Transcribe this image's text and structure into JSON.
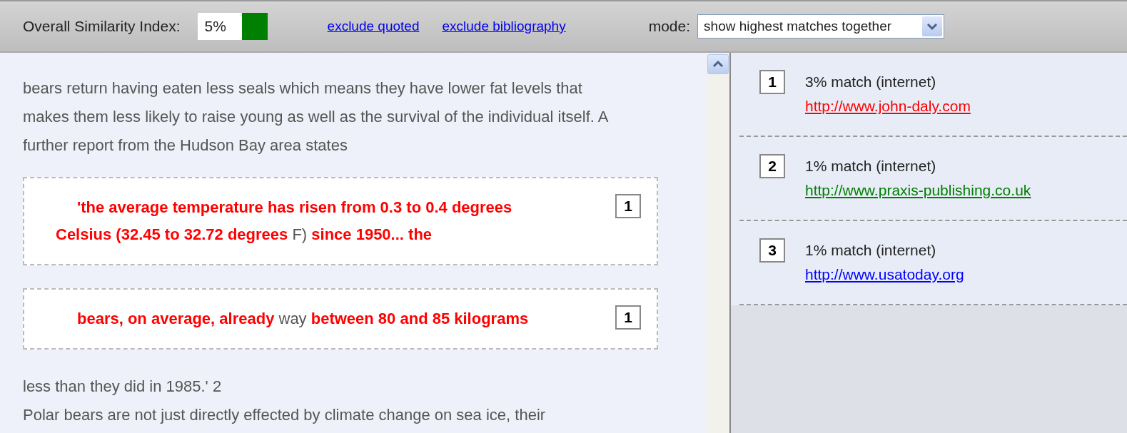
{
  "toolbar": {
    "similarity_label": "Overall Similarity Index:",
    "similarity_value": "5%",
    "links": [
      "exclude quoted",
      "exclude bibliography"
    ],
    "mode_label": "mode:",
    "mode_value": "show highest matches together"
  },
  "document": {
    "blocks": [
      {
        "kind": "paragraph",
        "text": "bears return having eaten less seals which means they have lower fat levels that makes them less likely to raise young as well as the survival of the individual itself. A further report from the Hudson Bay area states"
      },
      {
        "kind": "quote",
        "text": "**'the average temperature has risen from 0.3 to 0.4 degrees Celsius (32.45 to 32.72 degrees** F) **since 1950... the**",
        "source": "1"
      },
      {
        "kind": "quote",
        "text": "**bears, on average, already** way **between 80 and 85 kilograms**",
        "source": "1"
      },
      {
        "kind": "paragraph",
        "text": "less than they did in 1985.' 2"
      },
      {
        "kind": "paragraph",
        "text": "Polar bears are not just directly effected by climate change on sea ice, their"
      }
    ]
  },
  "matches": [
    {
      "number": "1",
      "summary": "3% match (internet)",
      "url": "http://www.john-daly.com",
      "color": "#ff0000"
    },
    {
      "number": "2",
      "summary": "1% match (internet)",
      "url": "http://www.praxis-publishing.co.uk",
      "color": "#008000"
    },
    {
      "number": "3",
      "summary": "1% match (internet)",
      "url": "http://www.usatoday.org",
      "color": "#0000ff"
    }
  ]
}
